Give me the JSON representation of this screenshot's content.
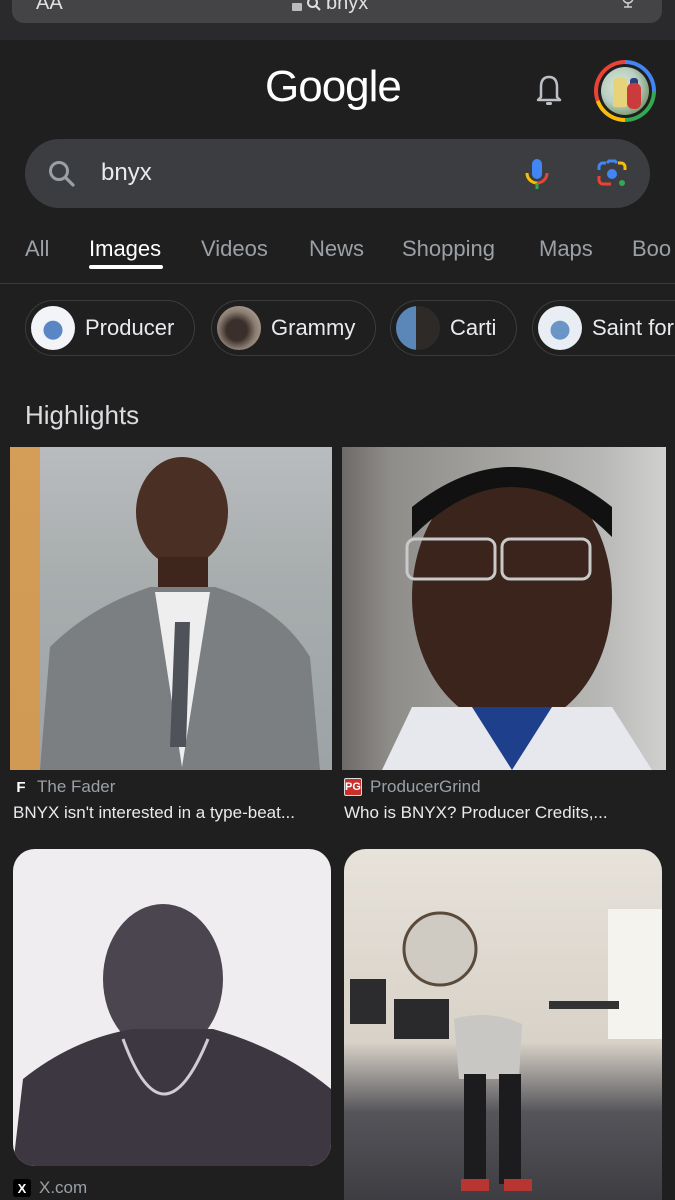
{
  "browser": {
    "text_size_label": "AA",
    "url": "bnyx"
  },
  "header": {
    "logo": "Google",
    "notifications_icon": "bell-icon",
    "account_icon": "avatar"
  },
  "search": {
    "query": "bnyx",
    "search_icon": "search-icon",
    "voice_icon": "mic-icon",
    "lens_icon": "google-lens-icon"
  },
  "tabs": [
    {
      "label": "All",
      "active": false
    },
    {
      "label": "Images",
      "active": true
    },
    {
      "label": "Videos",
      "active": false
    },
    {
      "label": "News",
      "active": false
    },
    {
      "label": "Shopping",
      "active": false
    },
    {
      "label": "Maps",
      "active": false
    },
    {
      "label": "Boo",
      "active": false
    }
  ],
  "chips": [
    {
      "label": "Producer"
    },
    {
      "label": "Grammy"
    },
    {
      "label": "Carti"
    },
    {
      "label": "Saint for"
    }
  ],
  "highlights": {
    "title": "Highlights",
    "results": [
      {
        "source": "The Fader",
        "favicon": "F",
        "title": "BNYX isn't interested in a type-beat..."
      },
      {
        "source": "ProducerGrind",
        "favicon": "PG",
        "title": "Who is BNYX? Producer Credits,..."
      },
      {
        "source": "X.com",
        "favicon": "X",
        "title": ""
      },
      {
        "source": "",
        "favicon": "",
        "title": ""
      }
    ]
  },
  "colors": {
    "background": "#1f1f1f",
    "search_box": "#3c3d40",
    "google_blue": "#4285f4",
    "google_red": "#ea4335",
    "google_yellow": "#fbbc05",
    "google_green": "#34a853"
  }
}
